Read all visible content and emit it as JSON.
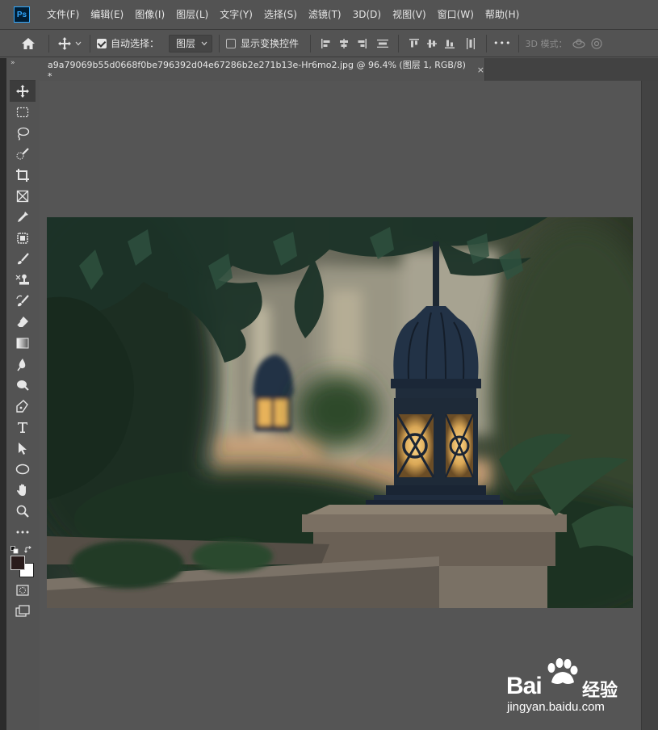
{
  "app": {
    "logo_text": "Ps"
  },
  "menu": {
    "items": [
      "文件(F)",
      "编辑(E)",
      "图像(I)",
      "图层(L)",
      "文字(Y)",
      "选择(S)",
      "滤镜(T)",
      "3D(D)",
      "视图(V)",
      "窗口(W)",
      "帮助(H)"
    ]
  },
  "options": {
    "auto_select_label": "自动选择：",
    "auto_select_checked": true,
    "layer_select_value": "图层",
    "show_transform_label": "显示变换控件",
    "show_transform_checked": false,
    "more_label": "•••",
    "mode_3d_label": "3D 模式："
  },
  "toolbar": {
    "collapse_label": "»"
  },
  "document": {
    "tab_title": "a9a79069b55d0668f0be796392d04e67286b2e271b13e-Hr6mo2.jpg @ 96.4% (图层 1, RGB/8) *",
    "close_label": "×"
  },
  "watermark": {
    "brand": "Bai",
    "brand_cn": "经验",
    "url": "jingyan.baidu.com"
  },
  "colors": {
    "foreground": "#2a1c1c",
    "background": "#ffffff",
    "accent": "#31a8ff"
  }
}
